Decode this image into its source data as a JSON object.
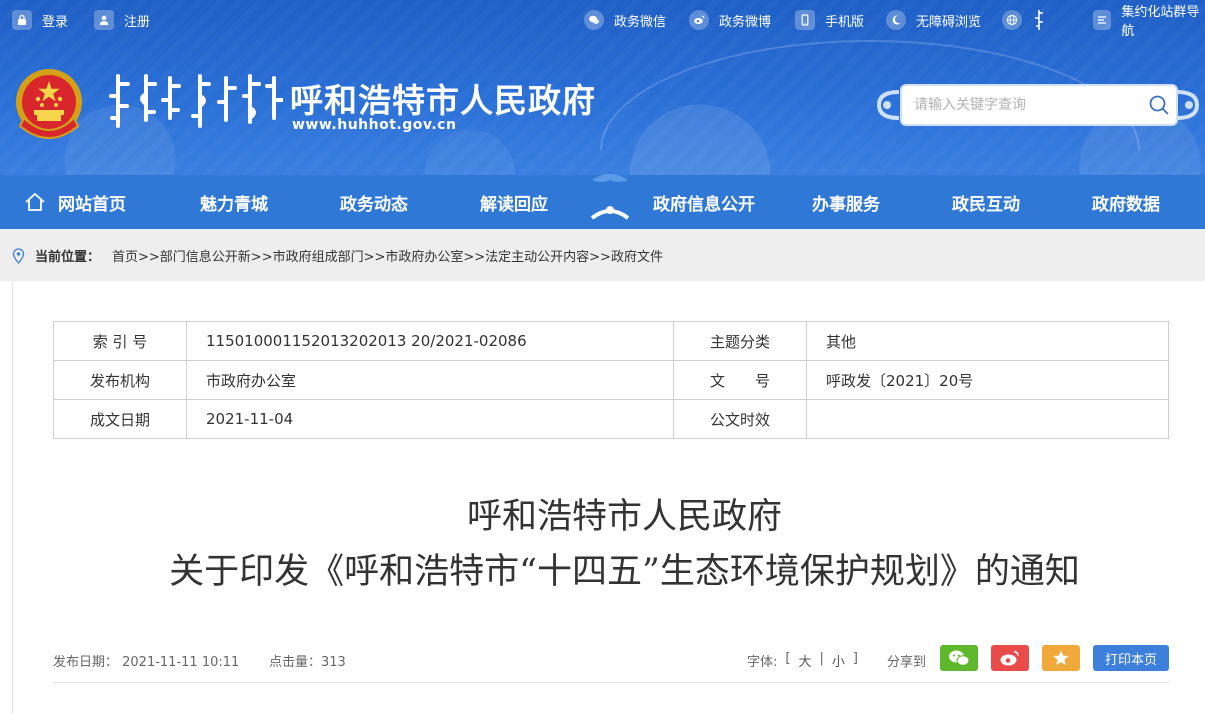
{
  "topbar": {
    "login": "登录",
    "register": "注册",
    "wechat": "政务微信",
    "weibo": "政务微博",
    "mobile": "手机版",
    "accessible": "无障碍浏览",
    "site_group": "集约化站群导航"
  },
  "header": {
    "title": "呼和浩特市人民政府",
    "url": "www.huhhot.gov.cn"
  },
  "search": {
    "placeholder": "请输入关键字查询",
    "value": ""
  },
  "nav": {
    "items": [
      {
        "label": "网站首页"
      },
      {
        "label": "魅力青城"
      },
      {
        "label": "政务动态"
      },
      {
        "label": "解读回应"
      },
      {
        "label": "政府信息公开"
      },
      {
        "label": "办事服务"
      },
      {
        "label": "政民互动"
      },
      {
        "label": "政府数据"
      }
    ]
  },
  "breadcrumb": {
    "label": "当前位置：",
    "path": "首页>>部门信息公开新>>市政府组成部门>>市政府办公室>>法定主动公开内容>>政府文件"
  },
  "meta": {
    "index_no_label": "索 引 号",
    "index_no": "115010001152013202013 20/2021-02086",
    "topic_label": "主题分类",
    "topic": "其他",
    "publisher_label": "发布机构",
    "publisher": "市政府办公室",
    "doc_no_label": "文　　号",
    "doc_no": "呼政发〔2021〕20号",
    "date_label": "成文日期",
    "date": "2021-11-04",
    "validity_label": "公文时效",
    "validity": ""
  },
  "article": {
    "title_line1": "呼和浩特市人民政府",
    "title_line2": "关于印发《呼和浩特市“十四五”生态环境保护规划》的通知",
    "pub_date": "发布日期：  2021-11-11 10:11",
    "clicks": "点击量：313",
    "font_label": "字体:",
    "font_open": "[",
    "font_large": "大",
    "font_sep": "|",
    "font_small": "小",
    "font_close": "]",
    "share_label": "分享到",
    "print": "打印本页"
  },
  "colors": {
    "header_blue": "#2a6fd6",
    "nav_blue": "#2f78d6",
    "wechat_green": "#5fb82b",
    "weibo_red": "#e94a4a",
    "star_orange": "#f2a93b",
    "print_blue": "#3d80dc"
  }
}
